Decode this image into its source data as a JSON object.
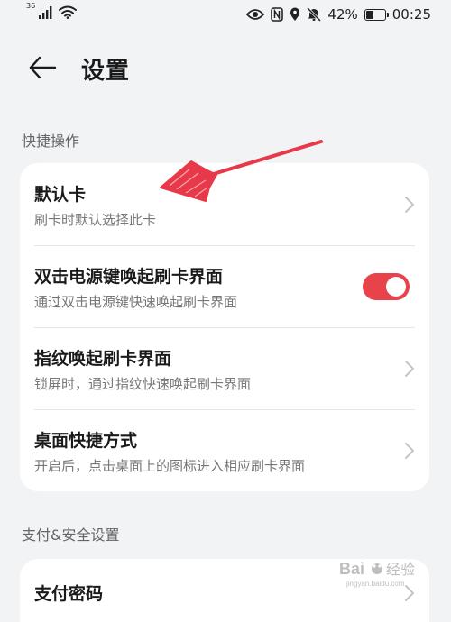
{
  "status_bar": {
    "network_type": "36",
    "battery_percent": "42%",
    "battery_level": 0.42,
    "time": "00:25",
    "icons": [
      "signal-icon",
      "wifi-icon",
      "eye-icon",
      "nfc-icon",
      "location-icon",
      "mute-icon",
      "battery-icon"
    ]
  },
  "header": {
    "back_icon": "arrow-left-icon",
    "title": "设置"
  },
  "sections": [
    {
      "title": "快捷操作",
      "items": [
        {
          "title": "默认卡",
          "subtitle": "刷卡时默认选择此卡",
          "control": "chevron"
        },
        {
          "title": "双击电源键唤起刷卡界面",
          "subtitle": "通过双击电源键快速唤起刷卡界面",
          "control": "toggle",
          "toggle_on": true
        },
        {
          "title": "指纹唤起刷卡界面",
          "subtitle": "锁屏时，通过指纹快速唤起刷卡界面",
          "control": "chevron"
        },
        {
          "title": "桌面快捷方式",
          "subtitle": "开启后，点击桌面上的图标进入相应刷卡界面",
          "control": "chevron"
        }
      ]
    },
    {
      "title": "支付&安全设置",
      "items": [
        {
          "title": "支付密码",
          "control": "chevron"
        }
      ]
    }
  ],
  "colors": {
    "background": "#f1f3f5",
    "card": "#ffffff",
    "toggle_on": "#e8424a",
    "annotation_arrow": "#e8394a"
  },
  "watermark": {
    "text": "Bai 经验",
    "url": "jingyan.baidu.com"
  }
}
